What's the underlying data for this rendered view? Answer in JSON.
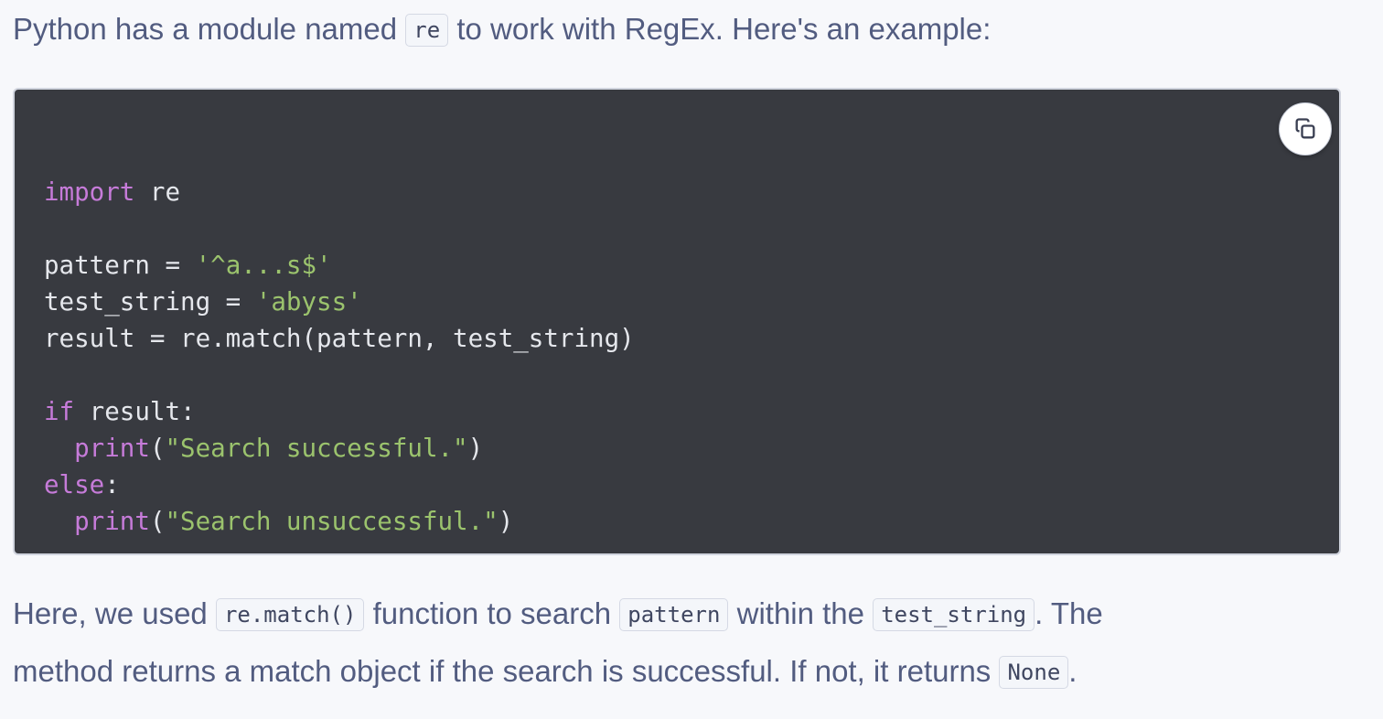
{
  "intro": {
    "text_before": "Python has a module named ",
    "code_re": "re",
    "text_after": " to work with RegEx. Here's an example:"
  },
  "code_block": {
    "copy_icon": "copy-icon",
    "lines": [
      [],
      [
        {
          "t": "import",
          "c": "kw"
        },
        {
          "t": " re",
          "c": "plain"
        }
      ],
      [],
      [
        {
          "t": "pattern = ",
          "c": "plain"
        },
        {
          "t": "'^a...s$'",
          "c": "str"
        }
      ],
      [
        {
          "t": "test_string = ",
          "c": "plain"
        },
        {
          "t": "'abyss'",
          "c": "str"
        }
      ],
      [
        {
          "t": "result = re.match(pattern, test_string)",
          "c": "plain"
        }
      ],
      [],
      [
        {
          "t": "if",
          "c": "kw"
        },
        {
          "t": " result:",
          "c": "plain"
        }
      ],
      [
        {
          "t": "  ",
          "c": "plain"
        },
        {
          "t": "print",
          "c": "kw"
        },
        {
          "t": "(",
          "c": "plain"
        },
        {
          "t": "\"Search successful.\"",
          "c": "str"
        },
        {
          "t": ")",
          "c": "plain"
        }
      ],
      [
        {
          "t": "else",
          "c": "kw"
        },
        {
          "t": ":",
          "c": "plain"
        }
      ],
      [
        {
          "t": "  ",
          "c": "plain"
        },
        {
          "t": "print",
          "c": "kw"
        },
        {
          "t": "(",
          "c": "plain"
        },
        {
          "t": "\"Search unsuccessful.\"",
          "c": "str"
        },
        {
          "t": ")",
          "c": "plain"
        }
      ]
    ]
  },
  "explanation": {
    "line1_a": "Here, we used ",
    "code_match": "re.match()",
    "line1_b": " function to search ",
    "code_pattern": "pattern",
    "line1_c": " within the ",
    "code_test_string": "test_string",
    "line1_d": ". The",
    "line2_a": "method returns a match object if the search is successful. If not, it returns ",
    "code_none": "None",
    "line2_b": "."
  },
  "colors": {
    "page_bg": "#f7f8fb",
    "body_text": "#525c80",
    "code_bg": "#383a40",
    "code_text": "#e5e7ec",
    "keyword": "#c67bd9",
    "string": "#9bc36d"
  }
}
